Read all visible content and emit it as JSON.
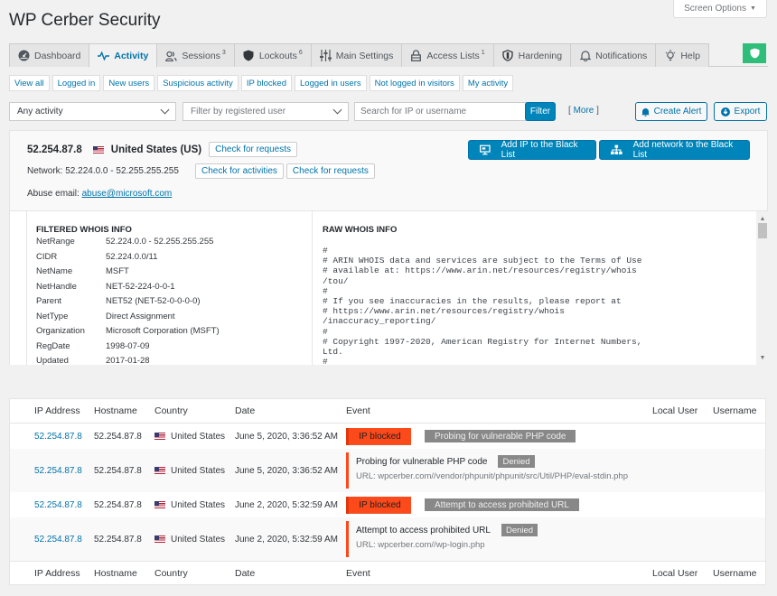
{
  "app": {
    "title": "WP Cerber Security",
    "screen_options": "Screen Options",
    "status_badge_color": "#2ebe7a"
  },
  "tabs": [
    {
      "label": "Dashboard",
      "icon": "dashboard-icon",
      "badge": ""
    },
    {
      "label": "Activity",
      "icon": "activity-pulse-icon",
      "badge": "",
      "active": true
    },
    {
      "label": "Sessions",
      "icon": "users-icon",
      "badge": "3"
    },
    {
      "label": "Lockouts",
      "icon": "shield-icon",
      "badge": "6"
    },
    {
      "label": "Main Settings",
      "icon": "sliders-icon",
      "badge": ""
    },
    {
      "label": "Access Lists",
      "icon": "lock-icon",
      "badge": "1"
    },
    {
      "label": "Hardening",
      "icon": "shield-outline-icon",
      "badge": ""
    },
    {
      "label": "Notifications",
      "icon": "bell-icon",
      "badge": ""
    },
    {
      "label": "Help",
      "icon": "lightbulb-icon",
      "badge": ""
    }
  ],
  "quick_filters": [
    "View all",
    "Logged in",
    "New users",
    "Suspicious activity",
    "IP blocked",
    "Logged in users",
    "Not logged in visitors",
    "My activity"
  ],
  "filters": {
    "activity_select": "Any activity",
    "user_select_placeholder": "Filter by registered user",
    "search_placeholder": "Search for IP or username",
    "filter_button": "Filter",
    "more_link": "More",
    "create_alert": "Create Alert",
    "export": "Export"
  },
  "ip_info": {
    "ip": "52.254.87.8",
    "country": "United States (US)",
    "check_requests": "Check for requests",
    "network_label": "Network: 52.224.0.0 - 52.255.255.255",
    "check_activities": "Check for activities",
    "check_requests_network": "Check for requests",
    "abuse_label": "Abuse email:",
    "abuse_email": "abuse@microsoft.com",
    "add_ip_blacklist": "Add IP to the Black List",
    "add_network_blacklist": "Add network to the Black List"
  },
  "whois": {
    "filtered_title": "FILTERED WHOIS INFO",
    "filtered": [
      {
        "key": "NetRange",
        "value": "52.224.0.0 - 52.255.255.255"
      },
      {
        "key": "CIDR",
        "value": "52.224.0.0/11"
      },
      {
        "key": "NetName",
        "value": "MSFT"
      },
      {
        "key": "NetHandle",
        "value": "NET-52-224-0-0-1"
      },
      {
        "key": "Parent",
        "value": "NET52 (NET-52-0-0-0-0)"
      },
      {
        "key": "NetType",
        "value": "Direct Assignment"
      },
      {
        "key": "Organization",
        "value": "Microsoft Corporation (MSFT)"
      },
      {
        "key": "RegDate",
        "value": "1998-07-09"
      },
      {
        "key": "Updated",
        "value": "2017-01-28"
      }
    ],
    "raw_title": "RAW WHOIS INFO",
    "raw_text": "#\n# ARIN WHOIS data and services are subject to the Terms of Use\n# available at: https://www.arin.net/resources/registry/whois\n/tou/\n#\n# If you see inaccuracies in the results, please report at\n# https://www.arin.net/resources/registry/whois\n/inaccuracy_reporting/\n#\n# Copyright 1997-2020, American Registry for Internet Numbers,\nLtd.\n#"
  },
  "table": {
    "columns": [
      "IP Address",
      "Hostname",
      "Country",
      "Date",
      "Event",
      "Local User",
      "Username"
    ],
    "rows": [
      {
        "ip": "52.254.87.8",
        "hostname": "52.254.87.8",
        "country": "United States",
        "date": "June 5, 2020, 3:36:52 AM",
        "type": "blocked",
        "status": "IP blocked",
        "reason": "Probing for vulnerable PHP code"
      },
      {
        "ip": "52.254.87.8",
        "hostname": "52.254.87.8",
        "country": "United States",
        "date": "June 5, 2020, 3:36:52 AM",
        "type": "event",
        "event": "Probing for vulnerable PHP code",
        "status": "Denied",
        "url": "URL: wpcerber.com//vendor/phpunit/phpunit/src/Util/PHP/eval-stdin.php"
      },
      {
        "ip": "52.254.87.8",
        "hostname": "52.254.87.8",
        "country": "United States",
        "date": "June 2, 2020, 5:32:59 AM",
        "type": "blocked",
        "status": "IP blocked",
        "reason": "Attempt to access prohibited URL"
      },
      {
        "ip": "52.254.87.8",
        "hostname": "52.254.87.8",
        "country": "United States",
        "date": "June 2, 2020, 5:32:59 AM",
        "type": "event",
        "event": "Attempt to access prohibited URL",
        "status": "Denied",
        "url": "URL: wpcerber.com//wp-login.php"
      }
    ]
  }
}
